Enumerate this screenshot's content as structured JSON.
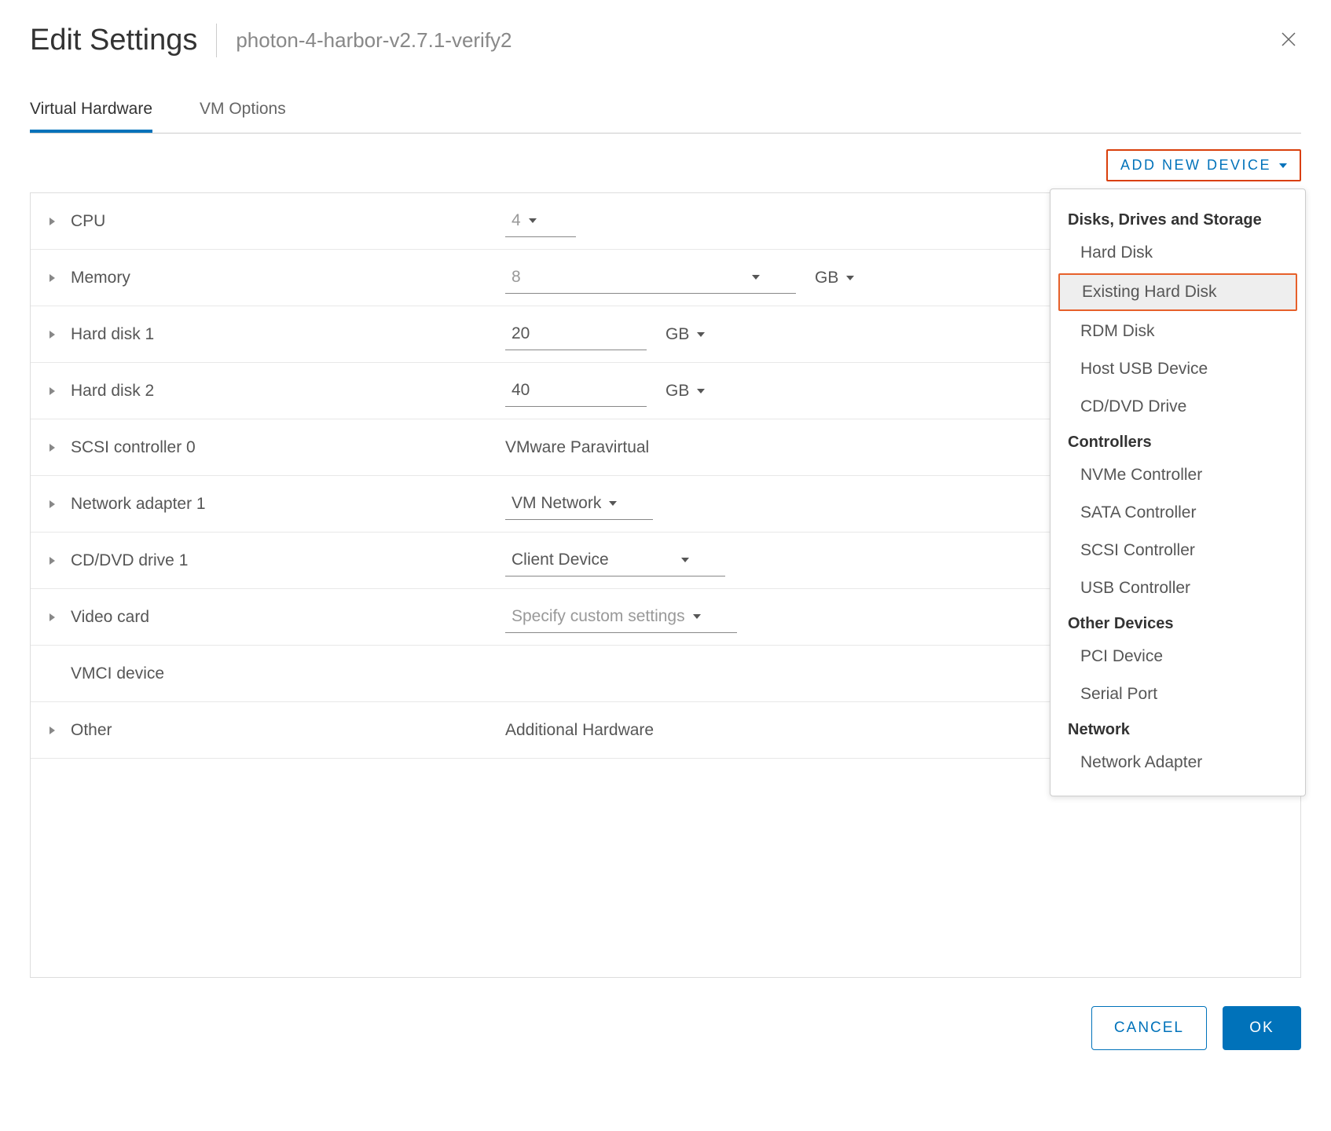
{
  "header": {
    "title": "Edit Settings",
    "subtitle": "photon-4-harbor-v2.7.1-verify2"
  },
  "tabs": [
    {
      "label": "Virtual Hardware",
      "active": true
    },
    {
      "label": "VM Options",
      "active": false
    }
  ],
  "toolbar": {
    "add_device_label": "ADD NEW DEVICE"
  },
  "rows": {
    "cpu": {
      "label": "CPU",
      "value": "4"
    },
    "memory": {
      "label": "Memory",
      "value": "8",
      "unit": "GB"
    },
    "hd1": {
      "label": "Hard disk 1",
      "value": "20",
      "unit": "GB"
    },
    "hd2": {
      "label": "Hard disk 2",
      "value": "40",
      "unit": "GB"
    },
    "scsi": {
      "label": "SCSI controller 0",
      "value": "VMware Paravirtual"
    },
    "net1": {
      "label": "Network adapter 1",
      "value": "VM Network"
    },
    "cddvd": {
      "label": "CD/DVD drive 1",
      "value": "Client Device"
    },
    "video": {
      "label": "Video card",
      "value": "Specify custom settings"
    },
    "vmci": {
      "label": "VMCI device"
    },
    "other": {
      "label": "Other",
      "value": "Additional Hardware"
    }
  },
  "dropdown": {
    "groups": [
      {
        "header": "Disks, Drives and Storage",
        "items": [
          "Hard Disk",
          "Existing Hard Disk",
          "RDM Disk",
          "Host USB Device",
          "CD/DVD Drive"
        ]
      },
      {
        "header": "Controllers",
        "items": [
          "NVMe Controller",
          "SATA Controller",
          "SCSI Controller",
          "USB Controller"
        ]
      },
      {
        "header": "Other Devices",
        "items": [
          "PCI Device",
          "Serial Port"
        ]
      },
      {
        "header": "Network",
        "items": [
          "Network Adapter"
        ]
      }
    ],
    "highlighted": "Existing Hard Disk"
  },
  "footer": {
    "cancel": "CANCEL",
    "ok": "OK"
  }
}
